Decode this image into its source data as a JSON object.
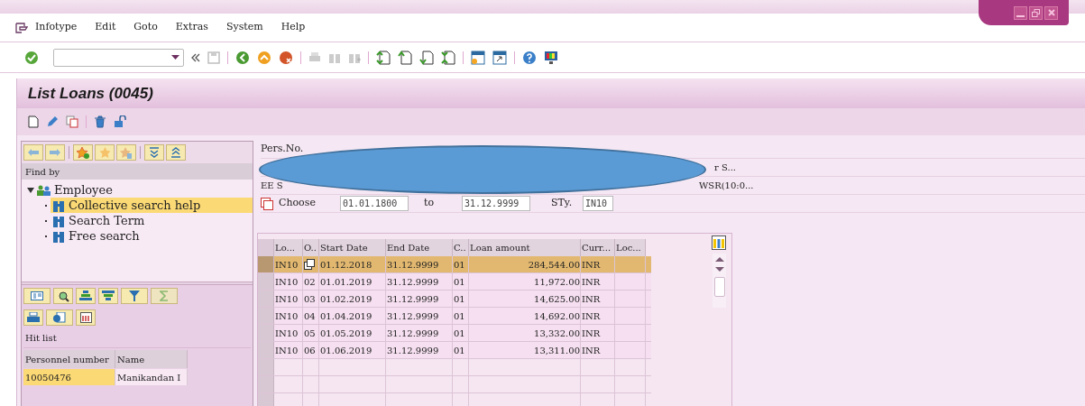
{
  "menu": [
    "Infotype",
    "Edit",
    "Goto",
    "Extras",
    "System",
    "Help"
  ],
  "title": "List Loans (0045)",
  "find_by": {
    "header": "Find by",
    "tree": [
      {
        "label": "Employee",
        "expanded": true,
        "children": [
          {
            "label": "Collective search help",
            "selected": true
          },
          {
            "label": "Search Term",
            "selected": false
          },
          {
            "label": "Free search",
            "selected": false
          }
        ]
      }
    ]
  },
  "hit_list": {
    "title": "Hit list",
    "columns": [
      "Personnel number",
      "Name"
    ],
    "rows": [
      {
        "cells": [
          "10050476",
          "Manikandan I"
        ],
        "selected": true
      }
    ]
  },
  "header_fields": {
    "pers_no_label": "Pers.No.",
    "fragment_right_1": "r S...",
    "fragment_left": "EE S",
    "fragment_right_2": "WSR(10:0...",
    "choose_label": "Choose",
    "from": "01.01.1800",
    "to_label": "to",
    "to": "31.12.9999",
    "sty_label": "STy.",
    "sty": "IN10"
  },
  "table": {
    "columns": [
      "Lo...",
      "O..",
      "Start Date",
      "End Date",
      "C..",
      "Loan amount",
      "Curr...",
      "Loc..."
    ],
    "rows": [
      {
        "lo": "IN10",
        "copy_icon": true,
        "start": "01.12.2018",
        "end": "31.12.9999",
        "c": "01",
        "amount": "284,544.00",
        "curr": "INR",
        "selected": true
      },
      {
        "lo": "IN10",
        "copy_icon": false,
        "o": "02",
        "start": "01.01.2019",
        "end": "31.12.9999",
        "c": "01",
        "amount": "11,972.00",
        "curr": "INR",
        "selected": false
      },
      {
        "lo": "IN10",
        "copy_icon": false,
        "o": "03",
        "start": "01.02.2019",
        "end": "31.12.9999",
        "c": "01",
        "amount": "14,625.00",
        "curr": "INR",
        "selected": false
      },
      {
        "lo": "IN10",
        "copy_icon": false,
        "o": "04",
        "start": "01.04.2019",
        "end": "31.12.9999",
        "c": "01",
        "amount": "14,692.00",
        "curr": "INR",
        "selected": false
      },
      {
        "lo": "IN10",
        "copy_icon": false,
        "o": "05",
        "start": "01.05.2019",
        "end": "31.12.9999",
        "c": "01",
        "amount": "13,332.00",
        "curr": "INR",
        "selected": false
      },
      {
        "lo": "IN10",
        "copy_icon": false,
        "o": "06",
        "start": "01.06.2019",
        "end": "31.12.9999",
        "c": "01",
        "amount": "13,311.00",
        "curr": "INR",
        "selected": false
      }
    ]
  }
}
